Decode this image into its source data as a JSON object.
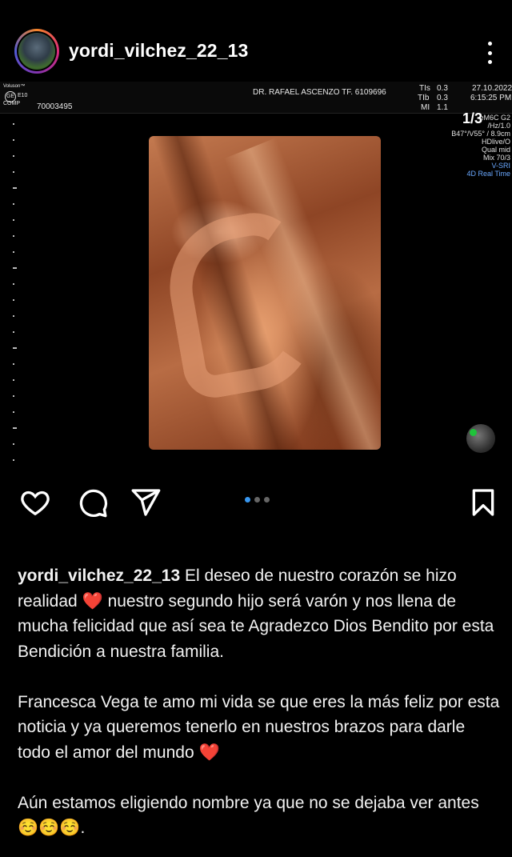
{
  "post": {
    "username": "yordi_vilchez_22_13",
    "image_counter": "1/3",
    "carousel": {
      "total": 3,
      "active": 1
    }
  },
  "ultrasound": {
    "brand_top": "Voluson™",
    "brand_model": "E10",
    "brand_comp": "COMP",
    "patient_id": "70003495",
    "doctor": "DR. RAFAEL ASCENZO TF. 6109696",
    "tis_label": "TIs",
    "tis_value": "0.3",
    "tib_label": "TIb",
    "tib_value": "0.3",
    "mi_label": "MI",
    "mi_value": "1.1",
    "date": "27.10.2022",
    "time": "6:15:25 PM",
    "side": [
      "eM6C G2",
      "/Hz/1.0",
      "B47°/V55° / 8.9cm",
      "HDlive/O",
      "Qual mid",
      "Mix 70/3"
    ],
    "side_blue": [
      "V-SRI",
      "4D Real Time"
    ]
  },
  "caption": {
    "username": "yordi_vilchez_22_13",
    "p1_a": "El deseo de nuestro corazón se hizo realidad",
    "p1_heart": "❤️",
    "p1_b": "nuestro segundo hijo será varón y nos llena de mucha felicidad que así sea te Agradezco Dios Bendito por esta Bendición a nuestra familia.",
    "p2_a": "Francesca Vega te amo mi vida se que eres la más feliz por esta noticia y ya queremos tenerlo en nuestros brazos para darle todo el amor del mundo",
    "p2_heart": "❤️",
    "p3_a": "Aún estamos eligiendo nombre ya que no se dejaba ver antes",
    "p3_emoji": "☺️☺️☺️",
    "p3_end": "."
  },
  "icons": {
    "like": "heart-outline-icon",
    "comment": "comment-bubble-icon",
    "share": "paper-plane-icon",
    "save": "bookmark-icon",
    "more": "more-vertical-icon"
  },
  "colors": {
    "background": "#000000",
    "text": "#ffffff",
    "carousel_active": "#3897f0",
    "heart": "#e0202a"
  }
}
